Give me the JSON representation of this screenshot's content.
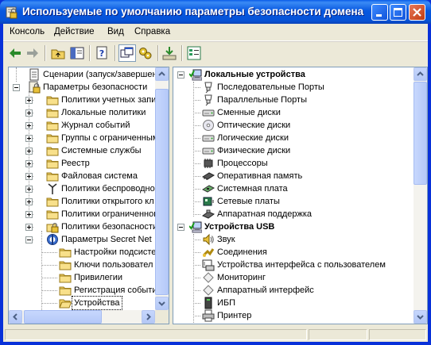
{
  "window": {
    "title": "Используемые по умолчанию параметры безопасности домена",
    "colors": {
      "titlebar": "#0758e0",
      "chrome": "#ece9d8",
      "border": "#0831d9"
    }
  },
  "menu": [
    "Консоль",
    "Действие",
    "Вид",
    "Справка"
  ],
  "toolbar": {
    "icons": [
      "back-icon",
      "forward-icon",
      "up-folder-icon",
      "show-hide-tree-icon",
      "help-icon",
      "new-window-icon",
      "settings-icon",
      "export-icon",
      "properties-icon"
    ]
  },
  "tree": {
    "items": [
      {
        "label": "Сценарии (запуск/завершен",
        "icon": "script-icon"
      },
      {
        "label": "Параметры безопасности",
        "icon": "security-icon"
      },
      {
        "label": "Политики учетных запи",
        "icon": "folder-icon"
      },
      {
        "label": "Локальные политики",
        "icon": "folder-icon"
      },
      {
        "label": "Журнал событий",
        "icon": "folder-icon"
      },
      {
        "label": "Группы с ограниченным",
        "icon": "folder-icon"
      },
      {
        "label": "Системные службы",
        "icon": "folder-icon"
      },
      {
        "label": "Реестр",
        "icon": "folder-icon"
      },
      {
        "label": "Файловая система",
        "icon": "folder-icon"
      },
      {
        "label": "Политики беспроводной",
        "icon": "antenna-icon"
      },
      {
        "label": "Политики открытого кл",
        "icon": "folder-icon"
      },
      {
        "label": "Политики ограниченног",
        "icon": "folder-icon"
      },
      {
        "label": "Политики безопасности",
        "icon": "shield-icon"
      },
      {
        "label": "Параметры Secret Net",
        "icon": "secretnet-icon"
      },
      {
        "label": "Настройки подсисте",
        "icon": "folder-icon"
      },
      {
        "label": "Ключи пользовател",
        "icon": "folder-icon"
      },
      {
        "label": "Привилегии",
        "icon": "folder-icon"
      },
      {
        "label": "Регистрация событи",
        "icon": "folder-icon"
      },
      {
        "label": "Устройства",
        "icon": "folder-open-icon"
      }
    ]
  },
  "details": {
    "items": [
      {
        "label": "Локальные устройства",
        "icon": "computer-check-icon",
        "group": true
      },
      {
        "label": "Последовательные Порты",
        "icon": "port-icon"
      },
      {
        "label": "Параллельные Порты",
        "icon": "port-icon"
      },
      {
        "label": "Сменные диски",
        "icon": "drive-icon"
      },
      {
        "label": "Оптические диски",
        "icon": "cd-icon"
      },
      {
        "label": "Логические диски",
        "icon": "drive-icon"
      },
      {
        "label": "Физические диски",
        "icon": "drive-icon"
      },
      {
        "label": "Процессоры",
        "icon": "chip-icon"
      },
      {
        "label": "Оперативная память",
        "icon": "memory-icon"
      },
      {
        "label": "Системная плата",
        "icon": "board-icon"
      },
      {
        "label": "Сетевые платы",
        "icon": "network-card-icon"
      },
      {
        "label": "Аппаратная поддержка",
        "icon": "hardware-icon"
      },
      {
        "label": "Устройства USB",
        "icon": "computer-check-icon",
        "group": true
      },
      {
        "label": "Звук",
        "icon": "speaker-icon"
      },
      {
        "label": "Соединения",
        "icon": "connection-icon"
      },
      {
        "label": "Устройства интерфейса с пользователем",
        "icon": "keyboard-icon"
      },
      {
        "label": "Мониторинг",
        "icon": "diamond-icon"
      },
      {
        "label": "Аппаратный интерфейс",
        "icon": "diamond-icon"
      },
      {
        "label": "ИБП",
        "icon": "ups-icon"
      },
      {
        "label": "Принтер",
        "icon": "printer-icon"
      }
    ]
  }
}
